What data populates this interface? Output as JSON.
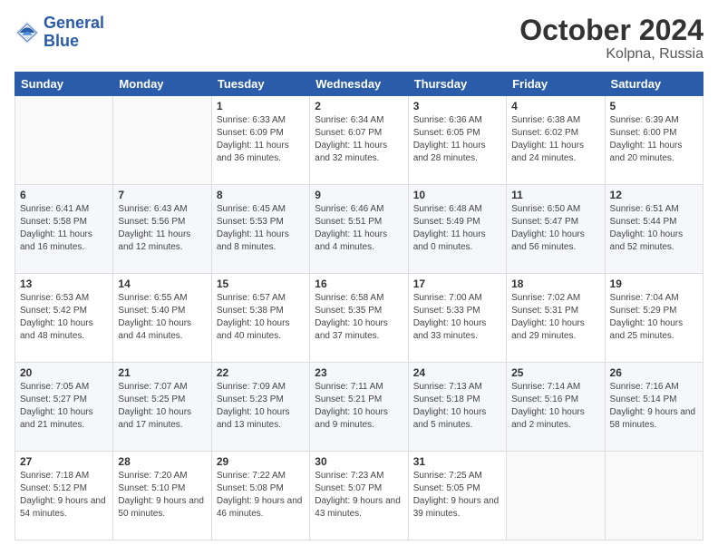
{
  "header": {
    "logo_line1": "General",
    "logo_line2": "Blue",
    "month_title": "October 2024",
    "subtitle": "Kolpna, Russia"
  },
  "days_of_week": [
    "Sunday",
    "Monday",
    "Tuesday",
    "Wednesday",
    "Thursday",
    "Friday",
    "Saturday"
  ],
  "weeks": [
    [
      {
        "day": "",
        "info": ""
      },
      {
        "day": "",
        "info": ""
      },
      {
        "day": "1",
        "info": "Sunrise: 6:33 AM\nSunset: 6:09 PM\nDaylight: 11 hours and 36 minutes."
      },
      {
        "day": "2",
        "info": "Sunrise: 6:34 AM\nSunset: 6:07 PM\nDaylight: 11 hours and 32 minutes."
      },
      {
        "day": "3",
        "info": "Sunrise: 6:36 AM\nSunset: 6:05 PM\nDaylight: 11 hours and 28 minutes."
      },
      {
        "day": "4",
        "info": "Sunrise: 6:38 AM\nSunset: 6:02 PM\nDaylight: 11 hours and 24 minutes."
      },
      {
        "day": "5",
        "info": "Sunrise: 6:39 AM\nSunset: 6:00 PM\nDaylight: 11 hours and 20 minutes."
      }
    ],
    [
      {
        "day": "6",
        "info": "Sunrise: 6:41 AM\nSunset: 5:58 PM\nDaylight: 11 hours and 16 minutes."
      },
      {
        "day": "7",
        "info": "Sunrise: 6:43 AM\nSunset: 5:56 PM\nDaylight: 11 hours and 12 minutes."
      },
      {
        "day": "8",
        "info": "Sunrise: 6:45 AM\nSunset: 5:53 PM\nDaylight: 11 hours and 8 minutes."
      },
      {
        "day": "9",
        "info": "Sunrise: 6:46 AM\nSunset: 5:51 PM\nDaylight: 11 hours and 4 minutes."
      },
      {
        "day": "10",
        "info": "Sunrise: 6:48 AM\nSunset: 5:49 PM\nDaylight: 11 hours and 0 minutes."
      },
      {
        "day": "11",
        "info": "Sunrise: 6:50 AM\nSunset: 5:47 PM\nDaylight: 10 hours and 56 minutes."
      },
      {
        "day": "12",
        "info": "Sunrise: 6:51 AM\nSunset: 5:44 PM\nDaylight: 10 hours and 52 minutes."
      }
    ],
    [
      {
        "day": "13",
        "info": "Sunrise: 6:53 AM\nSunset: 5:42 PM\nDaylight: 10 hours and 48 minutes."
      },
      {
        "day": "14",
        "info": "Sunrise: 6:55 AM\nSunset: 5:40 PM\nDaylight: 10 hours and 44 minutes."
      },
      {
        "day": "15",
        "info": "Sunrise: 6:57 AM\nSunset: 5:38 PM\nDaylight: 10 hours and 40 minutes."
      },
      {
        "day": "16",
        "info": "Sunrise: 6:58 AM\nSunset: 5:35 PM\nDaylight: 10 hours and 37 minutes."
      },
      {
        "day": "17",
        "info": "Sunrise: 7:00 AM\nSunset: 5:33 PM\nDaylight: 10 hours and 33 minutes."
      },
      {
        "day": "18",
        "info": "Sunrise: 7:02 AM\nSunset: 5:31 PM\nDaylight: 10 hours and 29 minutes."
      },
      {
        "day": "19",
        "info": "Sunrise: 7:04 AM\nSunset: 5:29 PM\nDaylight: 10 hours and 25 minutes."
      }
    ],
    [
      {
        "day": "20",
        "info": "Sunrise: 7:05 AM\nSunset: 5:27 PM\nDaylight: 10 hours and 21 minutes."
      },
      {
        "day": "21",
        "info": "Sunrise: 7:07 AM\nSunset: 5:25 PM\nDaylight: 10 hours and 17 minutes."
      },
      {
        "day": "22",
        "info": "Sunrise: 7:09 AM\nSunset: 5:23 PM\nDaylight: 10 hours and 13 minutes."
      },
      {
        "day": "23",
        "info": "Sunrise: 7:11 AM\nSunset: 5:21 PM\nDaylight: 10 hours and 9 minutes."
      },
      {
        "day": "24",
        "info": "Sunrise: 7:13 AM\nSunset: 5:18 PM\nDaylight: 10 hours and 5 minutes."
      },
      {
        "day": "25",
        "info": "Sunrise: 7:14 AM\nSunset: 5:16 PM\nDaylight: 10 hours and 2 minutes."
      },
      {
        "day": "26",
        "info": "Sunrise: 7:16 AM\nSunset: 5:14 PM\nDaylight: 9 hours and 58 minutes."
      }
    ],
    [
      {
        "day": "27",
        "info": "Sunrise: 7:18 AM\nSunset: 5:12 PM\nDaylight: 9 hours and 54 minutes."
      },
      {
        "day": "28",
        "info": "Sunrise: 7:20 AM\nSunset: 5:10 PM\nDaylight: 9 hours and 50 minutes."
      },
      {
        "day": "29",
        "info": "Sunrise: 7:22 AM\nSunset: 5:08 PM\nDaylight: 9 hours and 46 minutes."
      },
      {
        "day": "30",
        "info": "Sunrise: 7:23 AM\nSunset: 5:07 PM\nDaylight: 9 hours and 43 minutes."
      },
      {
        "day": "31",
        "info": "Sunrise: 7:25 AM\nSunset: 5:05 PM\nDaylight: 9 hours and 39 minutes."
      },
      {
        "day": "",
        "info": ""
      },
      {
        "day": "",
        "info": ""
      }
    ]
  ]
}
